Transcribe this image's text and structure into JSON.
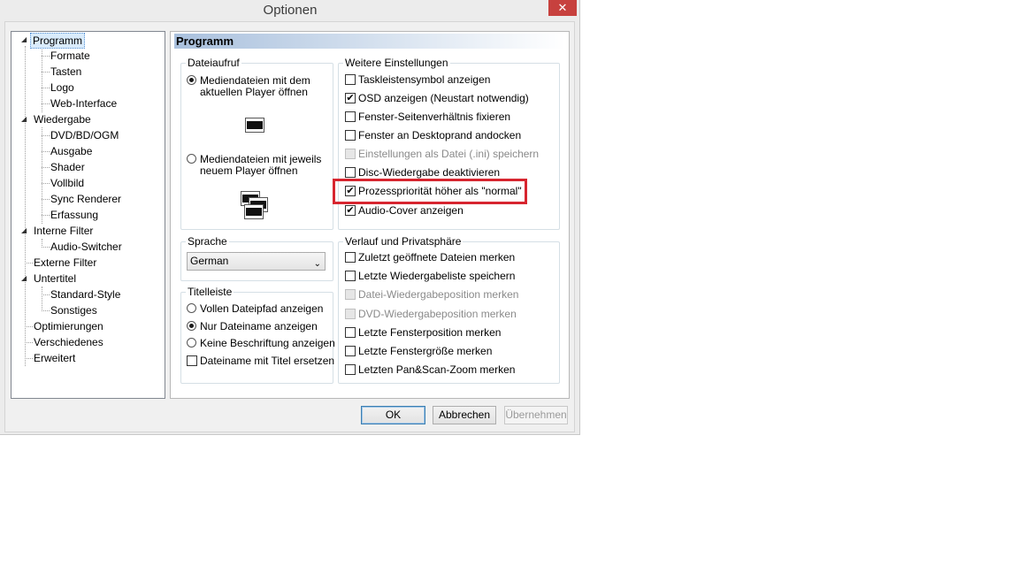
{
  "window": {
    "title": "Optionen",
    "close_glyph": "✕"
  },
  "tree": {
    "items": [
      {
        "label": "Programm"
      },
      {
        "label": "Formate"
      },
      {
        "label": "Tasten"
      },
      {
        "label": "Logo"
      },
      {
        "label": "Web-Interface"
      },
      {
        "label": "Wiedergabe"
      },
      {
        "label": "DVD/BD/OGM"
      },
      {
        "label": "Ausgabe"
      },
      {
        "label": "Shader"
      },
      {
        "label": "Vollbild"
      },
      {
        "label": "Sync Renderer"
      },
      {
        "label": "Erfassung"
      },
      {
        "label": "Interne Filter"
      },
      {
        "label": "Audio-Switcher"
      },
      {
        "label": "Externe Filter"
      },
      {
        "label": "Untertitel"
      },
      {
        "label": "Standard-Style"
      },
      {
        "label": "Sonstiges"
      },
      {
        "label": "Optimierungen"
      },
      {
        "label": "Verschiedenes"
      },
      {
        "label": "Erweitert"
      }
    ],
    "expander_glyph": "◢"
  },
  "panel": {
    "title": "Programm"
  },
  "dateiaufruf": {
    "legend": "Dateiaufruf",
    "option1": "Mediendateien mit dem aktuellen Player öffnen",
    "option2": "Mediendateien mit jeweils neuem Player öffnen",
    "selected": 1
  },
  "sprache": {
    "legend": "Sprache",
    "value": "German",
    "arrow": "⌄"
  },
  "titelleiste": {
    "legend": "Titelleiste",
    "option1": "Vollen Dateipfad anzeigen",
    "option2": "Nur Dateiname anzeigen",
    "option3": "Keine Beschriftung anzeigen",
    "checkbox": "Dateiname mit Titel ersetzen",
    "selected": 2
  },
  "weitere": {
    "legend": "Weitere Einstellungen",
    "items": [
      {
        "label": "Taskleistensymbol anzeigen",
        "checked": false,
        "disabled": false
      },
      {
        "label": "OSD anzeigen (Neustart notwendig)",
        "checked": true,
        "disabled": false
      },
      {
        "label": "Fenster-Seitenverhältnis fixieren",
        "checked": false,
        "disabled": false
      },
      {
        "label": "Fenster an Desktoprand andocken",
        "checked": false,
        "disabled": false
      },
      {
        "label": "Einstellungen als Datei (.ini) speichern",
        "checked": false,
        "disabled": true
      },
      {
        "label": "Disc-Wiedergabe deaktivieren",
        "checked": false,
        "disabled": false
      },
      {
        "label": "Prozesspriorität höher als \"normal\"",
        "checked": true,
        "disabled": false
      },
      {
        "label": "Audio-Cover anzeigen",
        "checked": true,
        "disabled": false
      }
    ]
  },
  "verlauf": {
    "legend": "Verlauf und Privatsphäre",
    "items": [
      {
        "label": "Zuletzt geöffnete Dateien merken",
        "checked": false,
        "disabled": false
      },
      {
        "label": "Letzte Wiedergabeliste speichern",
        "checked": false,
        "disabled": false
      },
      {
        "label": "Datei-Wiedergabeposition merken",
        "checked": false,
        "disabled": true
      },
      {
        "label": "DVD-Wiedergabeposition merken",
        "checked": false,
        "disabled": true
      },
      {
        "label": "Letzte Fensterposition merken",
        "checked": false,
        "disabled": false
      },
      {
        "label": "Letzte Fenstergröße merken",
        "checked": false,
        "disabled": false
      },
      {
        "label": "Letzten Pan&Scan-Zoom merken",
        "checked": false,
        "disabled": false
      }
    ]
  },
  "buttons": {
    "ok": "OK",
    "cancel": "Abbrechen",
    "apply": "Übernehmen"
  },
  "check_glyph": "✔",
  "colors": {
    "highlight_box": "#d7252f",
    "close_button": "#c7413e"
  }
}
